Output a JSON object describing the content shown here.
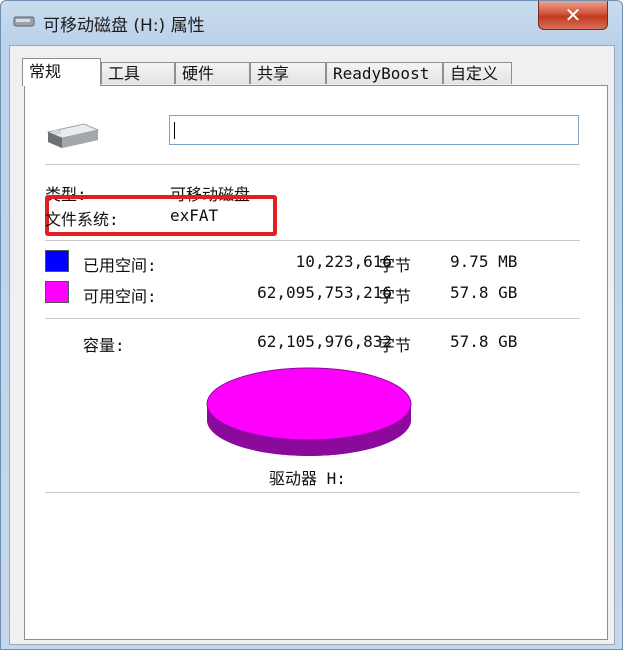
{
  "window": {
    "title": "可移动磁盘 (H:) 属性",
    "close_label": "✕"
  },
  "tabs": [
    {
      "label": "常规",
      "active": true
    },
    {
      "label": "工具"
    },
    {
      "label": "硬件"
    },
    {
      "label": "共享"
    },
    {
      "label": "ReadyBoost"
    },
    {
      "label": "自定义"
    }
  ],
  "general": {
    "drive_name_value": "",
    "type_label": "类型:",
    "type_value": "可移动磁盘",
    "fs_label": "文件系统:",
    "fs_value": "exFAT",
    "used_label": "已用空间:",
    "used_bytes": "10,223,616",
    "used_unit": "字节",
    "used_size": "9.75 MB",
    "free_label": "可用空间:",
    "free_bytes": "62,095,753,216",
    "free_unit": "字节",
    "free_size": "57.8 GB",
    "capacity_label": "容量:",
    "capacity_bytes": "62,105,976,832",
    "capacity_unit": "字节",
    "capacity_size": "57.8 GB",
    "drive_label": "驱动器 H:"
  },
  "colors": {
    "used": "#0000ff",
    "free": "#ff00ff",
    "pie_side": "#8b0a9c",
    "highlight": "#e02020"
  }
}
